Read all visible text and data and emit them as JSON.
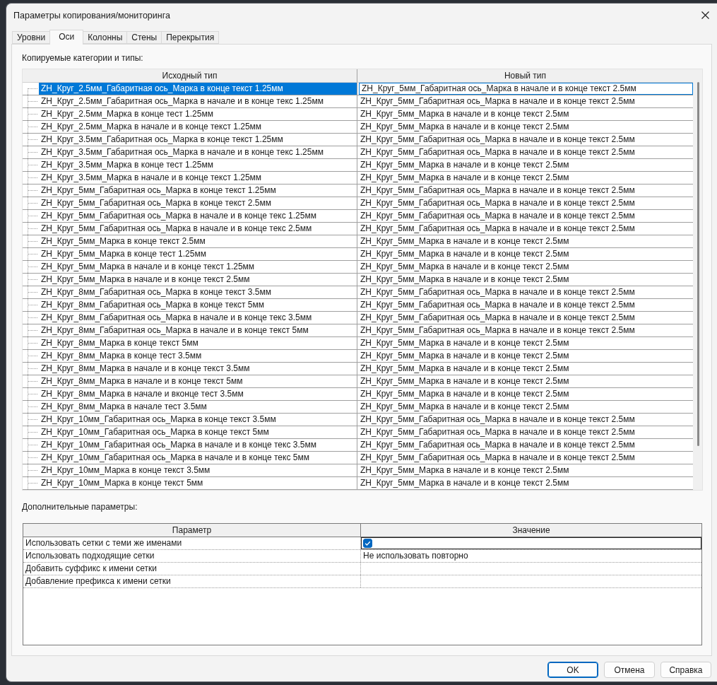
{
  "window": {
    "title": "Параметры копирования/мониторинга"
  },
  "tabs": [
    {
      "label": "Уровни",
      "selected": false
    },
    {
      "label": "Оси",
      "selected": true
    },
    {
      "label": "Колонны",
      "selected": false
    },
    {
      "label": "Стены",
      "selected": false
    },
    {
      "label": "Перекрытия",
      "selected": false
    }
  ],
  "types_section": {
    "label": "Копируемые категории и типы:",
    "columns": [
      "Исходный тип",
      "Новый тип"
    ],
    "rows": [
      {
        "source": "ZH_Круг_2.5мм_Габаритная ось_Марка в конце текст 1.25мм",
        "target": "ZH_Круг_5мм_Габаритная ось_Марка в начале и в конце текст 2.5мм",
        "selected": true
      },
      {
        "source": "ZH_Круг_2.5мм_Габаритная ось_Марка в начале и в конце текс 1.25мм",
        "target": "ZH_Круг_5мм_Габаритная ось_Марка в начале и в конце текст 2.5мм",
        "selected": false
      },
      {
        "source": "ZH_Круг_2.5мм_Марка в конце тест 1.25мм",
        "target": "ZH_Круг_5мм_Марка в начале и в конце текст 2.5мм",
        "selected": false
      },
      {
        "source": "ZH_Круг_2.5мм_Марка в начале и в конце текст 1.25мм",
        "target": "ZH_Круг_5мм_Марка в начале и в конце текст 2.5мм",
        "selected": false
      },
      {
        "source": "ZH_Круг_3.5мм_Габаритная ось_Марка в конце текст 1.25мм",
        "target": "ZH_Круг_5мм_Габаритная ось_Марка в начале и в конце текст 2.5мм",
        "selected": false
      },
      {
        "source": "ZH_Круг_3.5мм_Габаритная ось_Марка в начале и в конце текс 1.25мм",
        "target": "ZH_Круг_5мм_Габаритная ось_Марка в начале и в конце текст 2.5мм",
        "selected": false
      },
      {
        "source": "ZH_Круг_3.5мм_Марка в конце тест 1.25мм",
        "target": "ZH_Круг_5мм_Марка в начале и в конце текст 2.5мм",
        "selected": false
      },
      {
        "source": "ZH_Круг_3.5мм_Марка в начале и в конце текст 1.25мм",
        "target": "ZH_Круг_5мм_Марка в начале и в конце текст 2.5мм",
        "selected": false
      },
      {
        "source": "ZH_Круг_5мм_Габаритная ось_Марка в конце текст 1.25мм",
        "target": "ZH_Круг_5мм_Габаритная ось_Марка в начале и в конце текст 2.5мм",
        "selected": false
      },
      {
        "source": "ZH_Круг_5мм_Габаритная ось_Марка в конце текст 2.5мм",
        "target": "ZH_Круг_5мм_Габаритная ось_Марка в начале и в конце текст 2.5мм",
        "selected": false
      },
      {
        "source": "ZH_Круг_5мм_Габаритная ось_Марка в начале и в конце текс 1.25мм",
        "target": "ZH_Круг_5мм_Габаритная ось_Марка в начале и в конце текст 2.5мм",
        "selected": false
      },
      {
        "source": "ZH_Круг_5мм_Габаритная ось_Марка в начале и в конце текс 2.5мм",
        "target": "ZH_Круг_5мм_Габаритная ось_Марка в начале и в конце текст 2.5мм",
        "selected": false
      },
      {
        "source": "ZH_Круг_5мм_Марка в конце текст 2.5мм",
        "target": "ZH_Круг_5мм_Марка в начале и в конце текст 2.5мм",
        "selected": false
      },
      {
        "source": "ZH_Круг_5мм_Марка в конце тест 1.25мм",
        "target": "ZH_Круг_5мм_Марка в начале и в конце текст 2.5мм",
        "selected": false
      },
      {
        "source": "ZH_Круг_5мм_Марка в начале и в конце текст 1.25мм",
        "target": "ZH_Круг_5мм_Марка в начале и в конце текст 2.5мм",
        "selected": false
      },
      {
        "source": "ZH_Круг_5мм_Марка в начале и в конце текст 2.5мм",
        "target": "ZH_Круг_5мм_Марка в начале и в конце текст 2.5мм",
        "selected": false
      },
      {
        "source": "ZH_Круг_8мм_Габаритная ось_Марка в конце текст 3.5мм",
        "target": "ZH_Круг_5мм_Габаритная ось_Марка в начале и в конце текст 2.5мм",
        "selected": false
      },
      {
        "source": "ZH_Круг_8мм_Габаритная ось_Марка в конце текст 5мм",
        "target": "ZH_Круг_5мм_Габаритная ось_Марка в начале и в конце текст 2.5мм",
        "selected": false
      },
      {
        "source": "ZH_Круг_8мм_Габаритная ось_Марка в начале и в конце текс 3.5мм",
        "target": "ZH_Круг_5мм_Габаритная ось_Марка в начале и в конце текст 2.5мм",
        "selected": false
      },
      {
        "source": "ZH_Круг_8мм_Габаритная ось_Марка в начале и в конце текст 5мм",
        "target": "ZH_Круг_5мм_Габаритная ось_Марка в начале и в конце текст 2.5мм",
        "selected": false
      },
      {
        "source": "ZH_Круг_8мм_Марка в конце текст 5мм",
        "target": "ZH_Круг_5мм_Марка в начале и в конце текст 2.5мм",
        "selected": false
      },
      {
        "source": "ZH_Круг_8мм_Марка в конце тест 3.5мм",
        "target": "ZH_Круг_5мм_Марка в начале и в конце текст 2.5мм",
        "selected": false
      },
      {
        "source": "ZH_Круг_8мм_Марка в начале и в конце текст 3.5мм",
        "target": "ZH_Круг_5мм_Марка в начале и в конце текст 2.5мм",
        "selected": false
      },
      {
        "source": "ZH_Круг_8мм_Марка в начале и в конце текст 5мм",
        "target": "ZH_Круг_5мм_Марка в начале и в конце текст 2.5мм",
        "selected": false
      },
      {
        "source": "ZH_Круг_8мм_Марка в начале и вконце тест 3.5мм",
        "target": "ZH_Круг_5мм_Марка в начале и в конце текст 2.5мм",
        "selected": false
      },
      {
        "source": "ZH_Круг_8мм_Марка в начале тест 3.5мм",
        "target": "ZH_Круг_5мм_Марка в начале и в конце текст 2.5мм",
        "selected": false
      },
      {
        "source": "ZH_Круг_10мм_Габаритная ось_Марка в конце текст 3.5мм",
        "target": "ZH_Круг_5мм_Габаритная ось_Марка в начале и в конце текст 2.5мм",
        "selected": false
      },
      {
        "source": "ZH_Круг_10мм_Габаритная ось_Марка в конце текст 5мм",
        "target": "ZH_Круг_5мм_Габаритная ось_Марка в начале и в конце текст 2.5мм",
        "selected": false
      },
      {
        "source": "ZH_Круг_10мм_Габаритная ось_Марка в начале и в конце текс 3.5мм",
        "target": "ZH_Круг_5мм_Габаритная ось_Марка в начале и в конце текст 2.5мм",
        "selected": false
      },
      {
        "source": "ZH_Круг_10мм_Габаритная ось_Марка в начале и в конце текс 5мм",
        "target": "ZH_Круг_5мм_Габаритная ось_Марка в начале и в конце текст 2.5мм",
        "selected": false
      },
      {
        "source": "ZH_Круг_10мм_Марка в конце текст 3.5мм",
        "target": "ZH_Круг_5мм_Марка в начале и в конце текст 2.5мм",
        "selected": false
      },
      {
        "source": "ZH_Круг_10мм_Марка в конце текст 5мм",
        "target": "ZH_Круг_5мм_Марка в начале и в конце текст 2.5мм",
        "selected": false
      }
    ]
  },
  "extra_section": {
    "label": "Дополнительные параметры:",
    "columns": [
      "Параметр",
      "Значение"
    ],
    "rows": [
      {
        "name": "Использовать сетки с теми же именами",
        "kind": "checkbox",
        "checked": true,
        "focused": true
      },
      {
        "name": "Использовать подходящие сетки",
        "kind": "text",
        "value": "Не использовать повторно",
        "focused": false
      },
      {
        "name": "Добавить суффикс к имени сетки",
        "kind": "text",
        "focused": false
      },
      {
        "name": "Добавление префикса к имени сетки",
        "kind": "text",
        "focused": false
      }
    ]
  },
  "buttons": [
    {
      "label": "OK",
      "default": true
    },
    {
      "label": "Отмена",
      "default": false
    },
    {
      "label": "Справка",
      "default": false
    }
  ]
}
